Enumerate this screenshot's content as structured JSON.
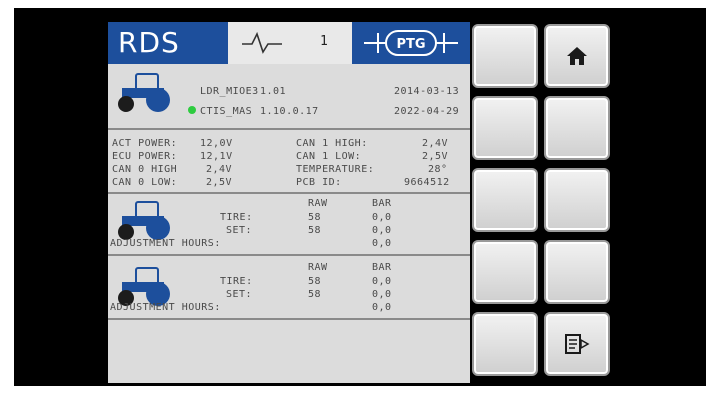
{
  "header": {
    "app_title": "RDS",
    "page_number": "1",
    "logo_text": "PTG"
  },
  "device_info": {
    "row1_name": "LDR_MIOE3",
    "row1_version": "1.01",
    "row1_date": "2014-03-13",
    "row2_name": "CTIS_MAS",
    "row2_version": "1.10.0.17",
    "row2_date": "2022-04-29",
    "status_color": "#2ecc40"
  },
  "measurements": {
    "left": [
      {
        "label": "ACT POWER:",
        "value": "12,0V"
      },
      {
        "label": "ECU POWER:",
        "value": "12,1V"
      },
      {
        "label": "CAN 0 HIGH",
        "value": "2,4V"
      },
      {
        "label": "CAN 0 LOW:",
        "value": "2,5V"
      }
    ],
    "right": [
      {
        "label": "CAN 1 HIGH:",
        "value": "2,4V"
      },
      {
        "label": "CAN 1 LOW:",
        "value": "2,5V"
      },
      {
        "label": "TEMPERATURE:",
        "value": "28°"
      },
      {
        "label": "PCB ID:",
        "value": "9664512"
      }
    ]
  },
  "axle1": {
    "col_raw": "RAW",
    "col_bar": "BAR",
    "tire_label": "TIRE:",
    "tire_raw": "58",
    "tire_bar": "0,0",
    "set_label": "SET:",
    "set_raw": "58",
    "set_bar": "0,0",
    "adj_label": "ADJUSTMENT HOURS:",
    "adj_value": "0,0"
  },
  "axle2": {
    "col_raw": "RAW",
    "col_bar": "BAR",
    "tire_label": "TIRE:",
    "tire_raw": "58",
    "tire_bar": "0,0",
    "set_label": "SET:",
    "set_raw": "58",
    "set_bar": "0,0",
    "adj_label": "ADJUSTMENT HOURS:",
    "adj_value": "0,0"
  },
  "keypad": {
    "icons": [
      "home-icon",
      "exit-icon"
    ],
    "brand_color": "#1d4f9c"
  }
}
